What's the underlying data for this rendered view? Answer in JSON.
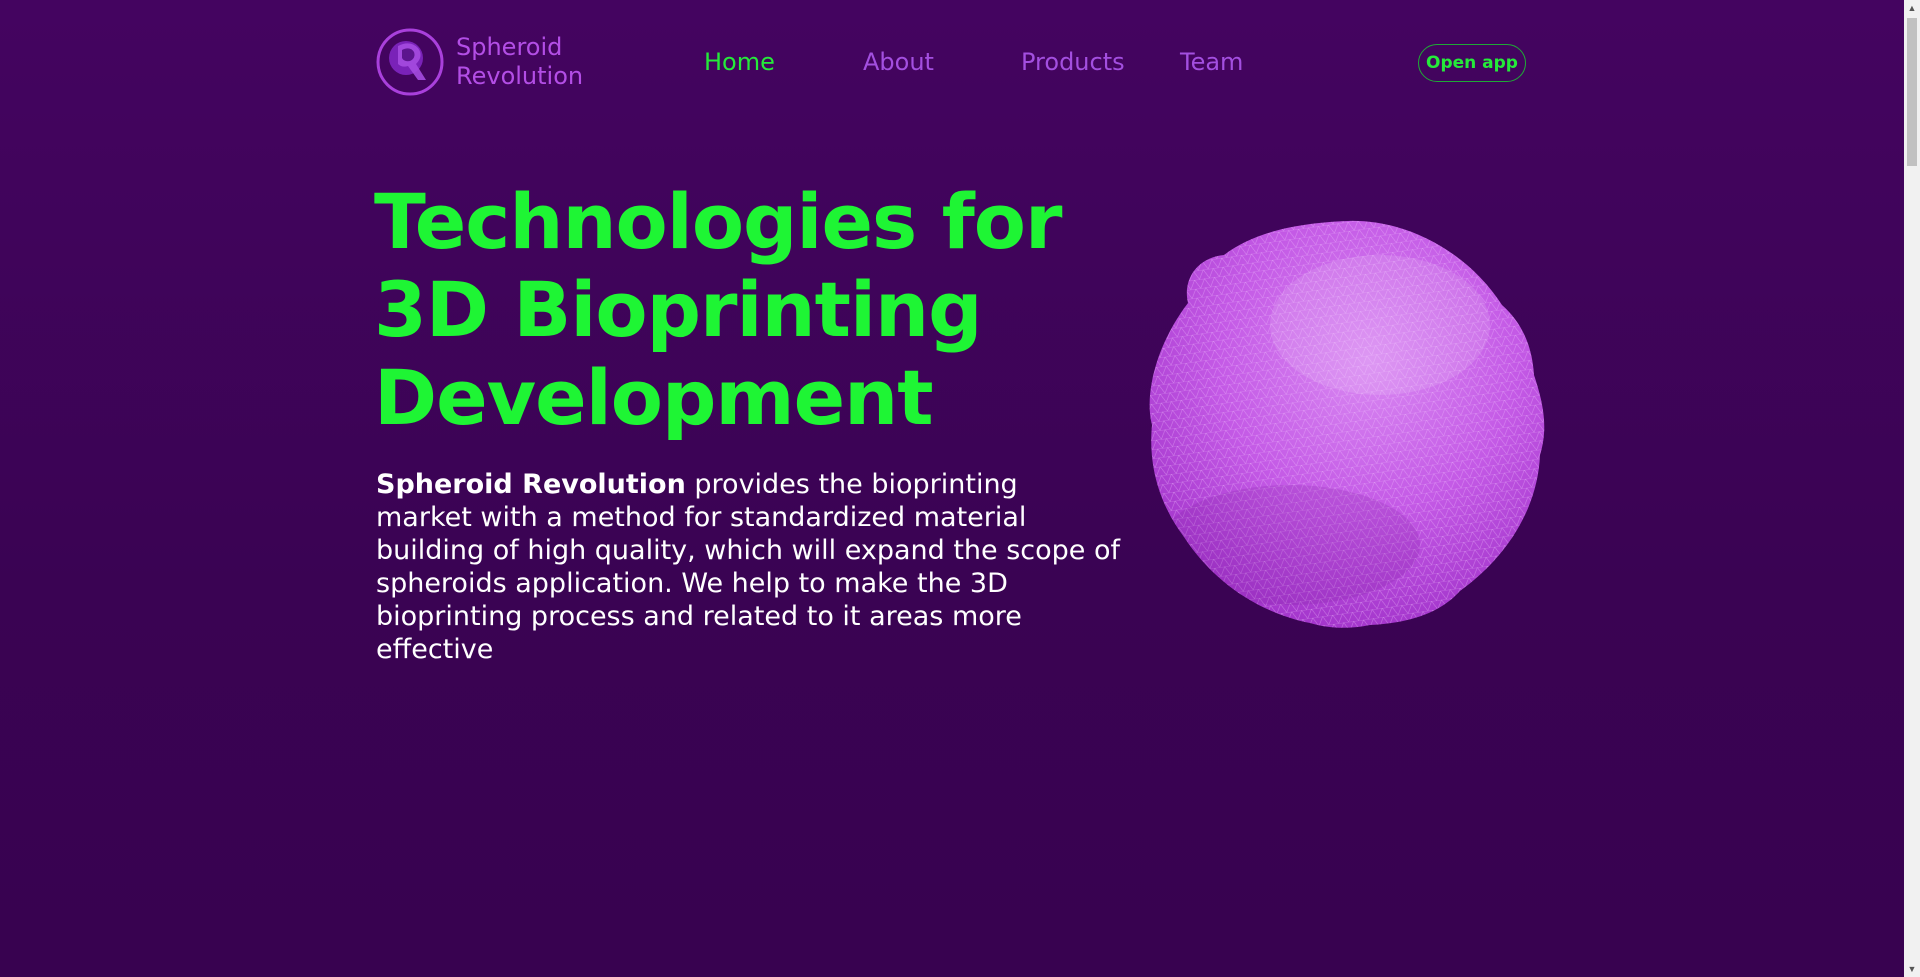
{
  "brand": {
    "line1": "Spheroid",
    "line2": "Revolution",
    "logo_icon": "spheroid-logo-icon"
  },
  "nav": {
    "items": [
      {
        "label": "Home",
        "active": true
      },
      {
        "label": "About"
      },
      {
        "label": "Products"
      },
      {
        "label": "Team"
      }
    ]
  },
  "header": {
    "cta_label": "Open app"
  },
  "hero": {
    "title_lines": [
      "Technologies for",
      "3D Bioprinting",
      "Development"
    ],
    "text_bold": "Spheroid Revolution",
    "text_rest": " provides the bioprinting market with a method for standardized material building of high quality, which will expand the scope of spheroids application. We help to make the 3D bioprinting process and related to it areas more effective",
    "image_icon": "wireframe-spheroid-icon"
  },
  "colors": {
    "background": "#440460",
    "accent_green": "#1ef534",
    "accent_purple": "#b34ee6",
    "sphere": "#c655e8"
  }
}
